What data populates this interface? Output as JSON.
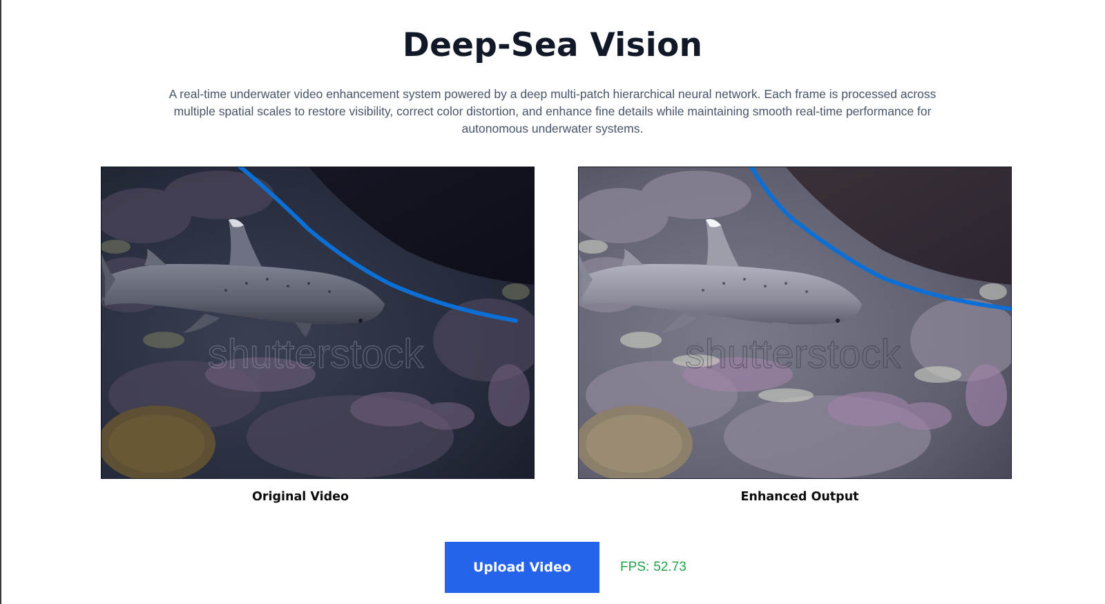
{
  "header": {
    "title": "Deep-Sea Vision",
    "description": "A real-time underwater video enhancement system powered by a deep multi-patch hierarchical neural network. Each frame is processed across multiple spatial scales to restore visibility, correct color distortion, and enhance fine details while maintaining smooth real-time performance for autonomous underwater systems."
  },
  "videos": {
    "original": {
      "caption": "Original Video",
      "watermark": "shutterstock"
    },
    "enhanced": {
      "caption": "Enhanced Output",
      "watermark": "shutterstock"
    }
  },
  "controls": {
    "upload_label": "Upload Video",
    "fps_label": "FPS:",
    "fps_value": "52.73"
  },
  "colors": {
    "accent": "#2563eb",
    "fps_text": "#22a34a",
    "annotation_stroke": "#0b6fd6"
  }
}
